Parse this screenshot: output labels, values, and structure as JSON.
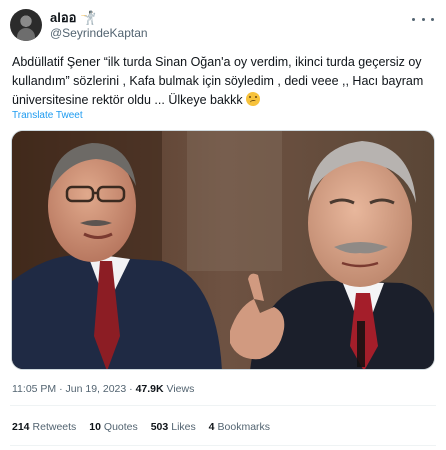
{
  "author": {
    "display_name": "alออ 🤺",
    "handle": "@SeyrindeKaptan"
  },
  "tweet": {
    "text": "Abdüllatif Şener “ilk turda Sinan Oğan'a oy verdim, ikinci turda geçersiz oy kullandım” sözlerini , Kafa bulmak için söyledim , dedi veee ,,  Hacı bayram üniversitesine rektör oldu ... Ülkeye bakkk",
    "emoji_icon": "woozy-face-emoji",
    "translate_label": "Translate Tweet"
  },
  "media": {
    "description_icon": "photo-two-men"
  },
  "meta": {
    "time": "11:05 PM",
    "date": "Jun 19, 2023",
    "views_count": "47.9K",
    "views_label": "Views"
  },
  "stats": [
    {
      "count": "214",
      "label": "Retweets"
    },
    {
      "count": "10",
      "label": "Quotes"
    },
    {
      "count": "503",
      "label": "Likes"
    },
    {
      "count": "4",
      "label": "Bookmarks"
    }
  ],
  "colors": {
    "link": "#1d9bf0",
    "secondary_text": "#536471",
    "primary_text": "#0f1419"
  }
}
